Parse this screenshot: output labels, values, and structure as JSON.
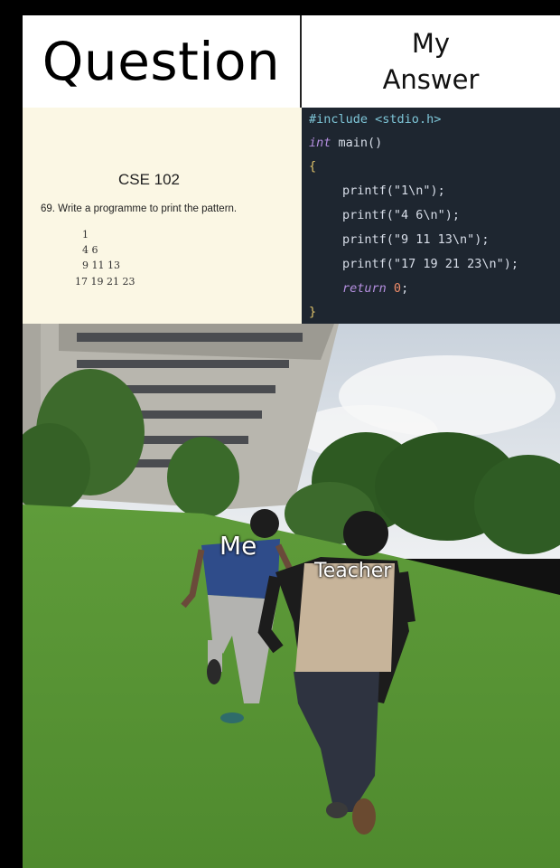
{
  "header": {
    "left_title": "Question",
    "right_title_line1": "My",
    "right_title_line2": "Answer"
  },
  "question": {
    "course": "CSE 102",
    "prompt": "69. Write a programme to print the pattern.",
    "pattern": [
      "1",
      "4  6",
      "9  11  13",
      "17  19  21  23"
    ]
  },
  "code": {
    "include_kw": "#include",
    "include_hdr": "<stdio.h>",
    "int_kw": "int",
    "main_sig": " main()",
    "open_brace": "{",
    "printf1": "printf(\"1\\n\");",
    "printf2": "printf(\"4 6\\n\");",
    "printf3": "printf(\"9 11 13\\n\");",
    "printf4": "printf(\"17 19 21 23\\n\");",
    "return_kw": "return",
    "return_val": "0",
    "semicolon": ";",
    "close_brace": "}"
  },
  "photo": {
    "label_me": "Me",
    "label_teacher": "Teacher"
  },
  "colors": {
    "code_bg": "#1e2630",
    "question_bg": "#fbf7e4",
    "grass": "#5e9a3a",
    "sky": "#dfe4ea"
  }
}
